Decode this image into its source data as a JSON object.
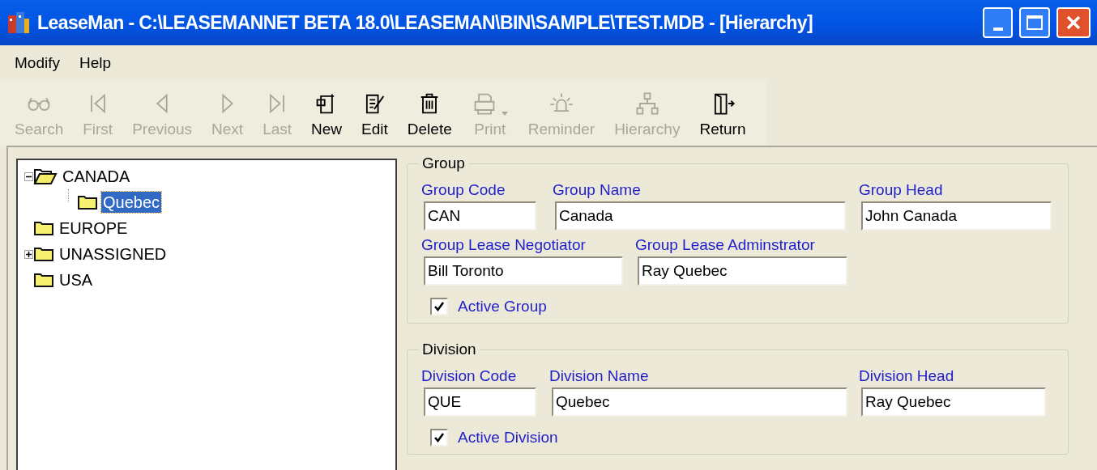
{
  "window": {
    "title": "LeaseMan - C:\\LEASEMANNET BETA 18.0\\LEASEMAN\\BIN\\SAMPLE\\TEST.MDB - [Hierarchy]"
  },
  "menu": [
    "Modify",
    "Help"
  ],
  "toolbar": [
    {
      "label": "Search",
      "disabled": true
    },
    {
      "label": "First",
      "disabled": true
    },
    {
      "label": "Previous",
      "disabled": true
    },
    {
      "label": "Next",
      "disabled": true
    },
    {
      "label": "Last",
      "disabled": true
    },
    {
      "label": "New",
      "disabled": false
    },
    {
      "label": "Edit",
      "disabled": false
    },
    {
      "label": "Delete",
      "disabled": false
    },
    {
      "label": "Print",
      "disabled": true
    },
    {
      "label": "Reminder",
      "disabled": true
    },
    {
      "label": "Hierarchy",
      "disabled": true
    },
    {
      "label": "Return",
      "disabled": false
    }
  ],
  "tree": [
    {
      "label": "CANADA",
      "expanded": true,
      "selected": false,
      "children": [
        {
          "label": "Quebec",
          "selected": true
        }
      ]
    },
    {
      "label": "EUROPE",
      "selected": false
    },
    {
      "label": "UNASSIGNED",
      "expanded": false,
      "selected": false
    },
    {
      "label": "USA",
      "selected": false
    }
  ],
  "sections": [
    {
      "title": "Group",
      "rows": [
        [
          {
            "label": "Group Code",
            "value": "CAN"
          },
          {
            "label": "Group Name",
            "value": "Canada"
          },
          {
            "label": "Group Head",
            "value": "John Canada"
          }
        ],
        [
          {
            "label": "Group Lease Negotiator",
            "value": "Bill Toronto"
          },
          {
            "label": "Group Lease Adminstrator",
            "value": "Ray Quebec"
          }
        ]
      ],
      "checkbox": {
        "label": "Active Group",
        "checked": true
      }
    },
    {
      "title": "Division",
      "rows": [
        [
          {
            "label": "Division Code",
            "value": "QUE"
          },
          {
            "label": "Division Name",
            "value": "Quebec"
          },
          {
            "label": "Division Head",
            "value": "Ray Quebec"
          }
        ]
      ],
      "checkbox": {
        "label": "Active Division",
        "checked": true
      }
    }
  ]
}
